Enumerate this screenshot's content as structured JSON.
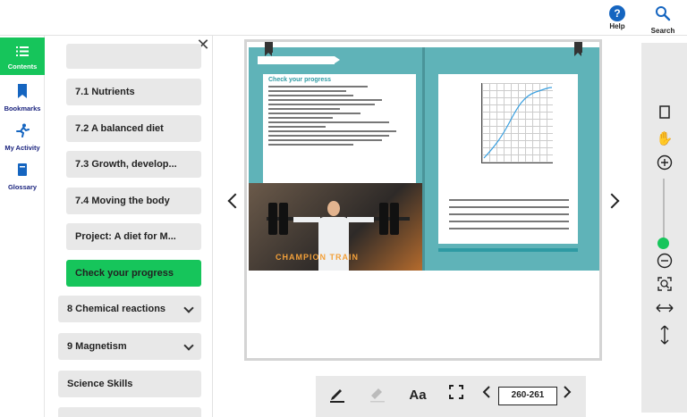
{
  "topbar": {
    "help_label": "Help",
    "search_label": "Search"
  },
  "rail": {
    "items": [
      {
        "label": "Contents",
        "icon": "list-icon",
        "active": true
      },
      {
        "label": "Bookmarks",
        "icon": "bookmark-icon"
      },
      {
        "label": "My Activity",
        "icon": "running-person-icon"
      },
      {
        "label": "Glossary",
        "icon": "glossary-icon"
      }
    ]
  },
  "contents": {
    "close_icon": "close-icon",
    "items": [
      {
        "label": "7.1 Nutrients"
      },
      {
        "label": "7.2 A balanced diet"
      },
      {
        "label": "7.3 Growth, develop..."
      },
      {
        "label": "7.4 Moving the body"
      },
      {
        "label": "Project: A diet for M..."
      },
      {
        "label": "Check your progress",
        "active": true
      },
      {
        "label": "8 Chemical reactions"
      },
      {
        "label": "9 Magnetism"
      },
      {
        "label": "Science Skills"
      }
    ]
  },
  "book": {
    "left_title": "Check your progress",
    "gym_sign": "CHAMPION TRAIN"
  },
  "bottom": {
    "page_range": "260-261",
    "font_label": "Aa"
  },
  "colors": {
    "accent_green": "#16c55b",
    "book_teal": "#5fb3b8",
    "help_blue": "#1565c0"
  }
}
